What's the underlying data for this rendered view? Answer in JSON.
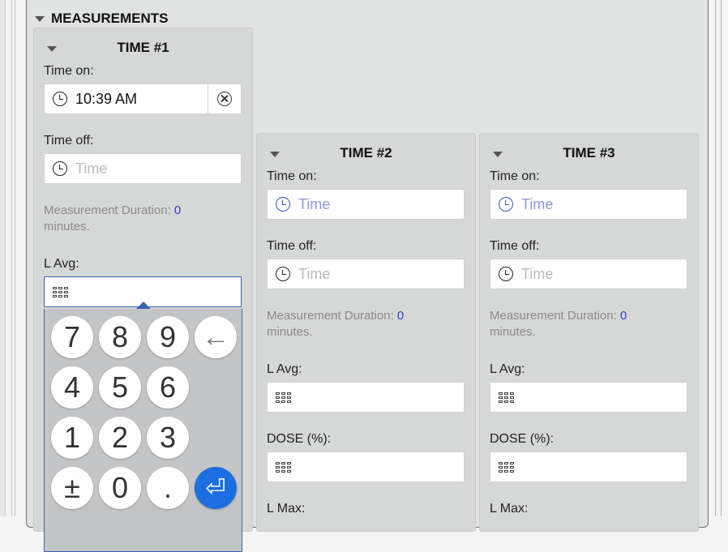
{
  "section": {
    "title": "MEASUREMENTS"
  },
  "cards": [
    {
      "title": "TIME #1",
      "time_on_label": "Time on:",
      "time_on_value": "10:39 AM",
      "time_off_label": "Time off:",
      "time_off_placeholder": "Time",
      "duration_label": "Measurement Duration:",
      "duration_value": "0",
      "duration_unit": "minutes.",
      "lavg_label": "L Avg:"
    },
    {
      "title": "TIME #2",
      "time_on_label": "Time on:",
      "time_on_placeholder": "Time",
      "time_off_label": "Time off:",
      "time_off_placeholder": "Time",
      "duration_label": "Measurement Duration:",
      "duration_value": "0",
      "duration_unit": "minutes.",
      "lavg_label": "L Avg:",
      "dose_label": "DOSE (%):",
      "lmax_label": "L Max:"
    },
    {
      "title": "TIME #3",
      "time_on_label": "Time on:",
      "time_on_placeholder": "Time",
      "time_off_label": "Time off:",
      "time_off_placeholder": "Time",
      "duration_label": "Measurement Duration:",
      "duration_value": "0",
      "duration_unit": "minutes.",
      "lavg_label": "L Avg:",
      "dose_label": "DOSE (%):",
      "lmax_label": "L Max:"
    }
  ],
  "numpad": {
    "keys": [
      "7",
      "8",
      "9",
      "←",
      "4",
      "5",
      "6",
      "1",
      "2",
      "3",
      "±",
      "0",
      ".",
      "⏎"
    ],
    "icons": {
      "backspace": "left-arrow-icon",
      "enter": "enter-icon"
    },
    "enter_color": "#1b6fe0"
  }
}
